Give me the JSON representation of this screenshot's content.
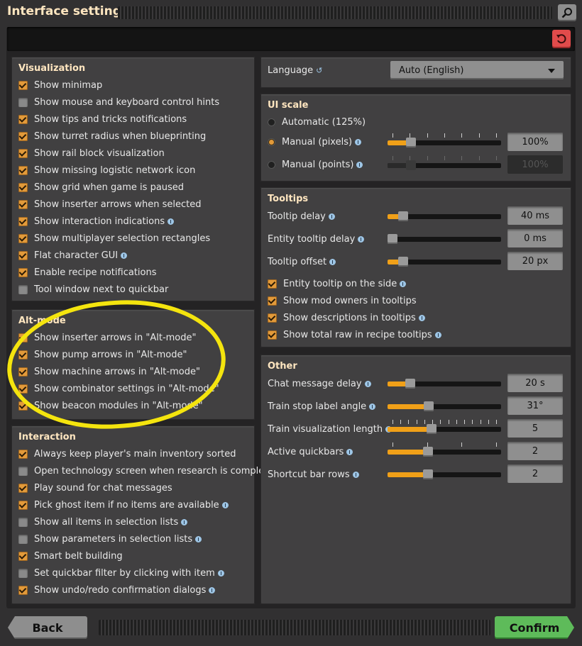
{
  "window": {
    "title": "Interface settings"
  },
  "left": {
    "visualization": {
      "title": "Visualization",
      "items": [
        {
          "label": "Show minimap",
          "checked": true,
          "info": false
        },
        {
          "label": "Show mouse and keyboard control hints",
          "checked": false,
          "info": false
        },
        {
          "label": "Show tips and tricks notifications",
          "checked": true,
          "info": false
        },
        {
          "label": "Show turret radius when blueprinting",
          "checked": true,
          "info": false
        },
        {
          "label": "Show rail block visualization",
          "checked": true,
          "info": false
        },
        {
          "label": "Show missing logistic network icon",
          "checked": true,
          "info": false
        },
        {
          "label": "Show grid when game is paused",
          "checked": true,
          "info": false
        },
        {
          "label": "Show inserter arrows when selected",
          "checked": true,
          "info": false
        },
        {
          "label": "Show interaction indications",
          "checked": true,
          "info": true
        },
        {
          "label": "Show multiplayer selection rectangles",
          "checked": true,
          "info": false
        },
        {
          "label": "Flat character GUI",
          "checked": true,
          "info": true
        },
        {
          "label": "Enable recipe notifications",
          "checked": true,
          "info": false
        },
        {
          "label": "Tool window next to quickbar",
          "checked": false,
          "info": false
        }
      ]
    },
    "altmode": {
      "title": "Alt-mode",
      "items": [
        {
          "label": "Show inserter arrows in \"Alt-mode\"",
          "checked": true,
          "info": false
        },
        {
          "label": "Show pump arrows in \"Alt-mode\"",
          "checked": true,
          "info": false
        },
        {
          "label": "Show machine arrows in \"Alt-mode\"",
          "checked": true,
          "info": false
        },
        {
          "label": "Show combinator settings in \"Alt-mode\"",
          "checked": true,
          "info": false
        },
        {
          "label": "Show beacon modules in \"Alt-mode\"",
          "checked": true,
          "info": false
        }
      ]
    },
    "interaction": {
      "title": "Interaction",
      "items": [
        {
          "label": "Always keep player's main inventory sorted",
          "checked": true,
          "info": false
        },
        {
          "label": "Open technology screen when research is completed",
          "checked": false,
          "info": false
        },
        {
          "label": "Play sound for chat messages",
          "checked": true,
          "info": false
        },
        {
          "label": "Pick ghost item if no items are available",
          "checked": true,
          "info": true
        },
        {
          "label": "Show all items in selection lists",
          "checked": false,
          "info": true
        },
        {
          "label": "Show parameters in selection lists",
          "checked": false,
          "info": true
        },
        {
          "label": "Smart belt building",
          "checked": true,
          "info": false
        },
        {
          "label": "Set quickbar filter by clicking with item",
          "checked": false,
          "info": true
        },
        {
          "label": "Show undo/redo confirmation dialogs",
          "checked": true,
          "info": true
        }
      ]
    }
  },
  "right": {
    "language": {
      "label": "Language",
      "value": "Auto (English)"
    },
    "uiscale": {
      "title": "UI scale",
      "automatic_label": "Automatic (125%)",
      "manual_pixels_label": "Manual (pixels)",
      "manual_pixels_value": "100%",
      "manual_pixels_fraction": 0.18,
      "manual_points_label": "Manual (points)",
      "manual_points_value": "100%",
      "manual_points_fraction": 0.18,
      "selected": "manual_pixels"
    },
    "tooltips": {
      "title": "Tooltips",
      "sliders": [
        {
          "label": "Tooltip delay",
          "value": "40 ms",
          "fraction": 0.1
        },
        {
          "label": "Entity tooltip delay",
          "value": "0 ms",
          "fraction": 0.0
        },
        {
          "label": "Tooltip offset",
          "value": "20 px",
          "fraction": 0.1
        }
      ],
      "checks": [
        {
          "label": "Entity tooltip on the side",
          "checked": true,
          "info": true
        },
        {
          "label": "Show mod owners in tooltips",
          "checked": true,
          "info": false
        },
        {
          "label": "Show descriptions in tooltips",
          "checked": true,
          "info": true
        },
        {
          "label": "Show total raw in recipe tooltips",
          "checked": true,
          "info": true
        }
      ]
    },
    "other": {
      "title": "Other",
      "sliders": [
        {
          "label": "Chat message delay",
          "value": "20 s",
          "fraction": 0.17
        },
        {
          "label": "Train stop label angle",
          "value": "31°",
          "fraction": 0.35
        },
        {
          "label": "Train visualization length",
          "value": "5",
          "fraction": 0.38
        },
        {
          "label": "Active quickbars",
          "value": "2",
          "fraction": 0.34
        },
        {
          "label": "Shortcut bar rows",
          "value": "2",
          "fraction": 0.34
        }
      ]
    }
  },
  "buttons": {
    "back": "Back",
    "confirm": "Confirm"
  },
  "colors": {
    "accent": "#e29a3a",
    "confirm": "#5ebb5a",
    "reset": "#e14b4b",
    "highlight": "#f4e40e"
  }
}
